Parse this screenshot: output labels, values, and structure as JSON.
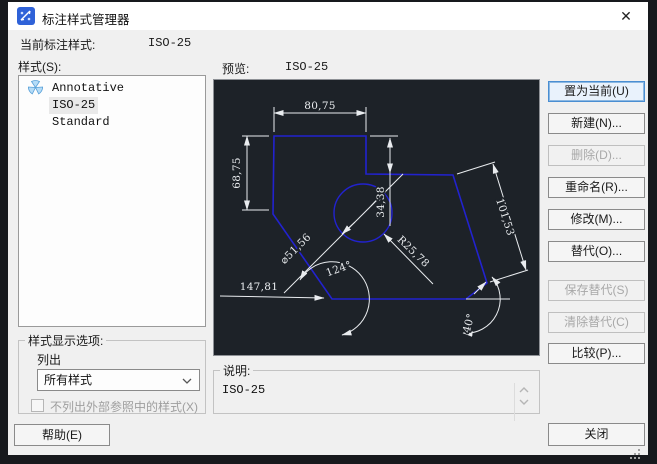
{
  "window": {
    "title": "标注样式管理器",
    "close_glyph": "✕"
  },
  "current": {
    "label": "当前标注样式:",
    "value": "ISO-25"
  },
  "styles": {
    "label": "样式(S):",
    "items": [
      "Annotative",
      "ISO-25",
      "Standard"
    ]
  },
  "preview": {
    "label": "预览:",
    "value": "ISO-25",
    "dims": {
      "top": "80,75",
      "left": "68,75",
      "middle": "34,38",
      "aligned": "101,53",
      "radius": "R25,78",
      "diameter": "⌀51,56",
      "angle": "124°",
      "bottom": "147,81",
      "angle2": "40°"
    }
  },
  "options": {
    "group_label": "样式显示选项:",
    "list_label": "列出",
    "dropdown_value": "所有样式",
    "xref_checkbox_label": "不列出外部参照中的样式(X)"
  },
  "description": {
    "label": "说明:",
    "text": "ISO-25"
  },
  "buttons": {
    "set_current": "置为当前(U)",
    "new": "新建(N)...",
    "delete": "删除(D)...",
    "rename": "重命名(R)...",
    "modify": "修改(M)...",
    "override": "替代(O)...",
    "save_override": "保存替代(S)",
    "clear_override": "清除替代(C)",
    "compare": "比较(P)...",
    "close": "关闭",
    "help": "帮助(E)"
  },
  "colors": {
    "preview_bg": "#1d2228",
    "geometry_blue": "#2222cf",
    "dimension_white": "#e9ecef",
    "default_button_border": "#4a8ed2"
  }
}
